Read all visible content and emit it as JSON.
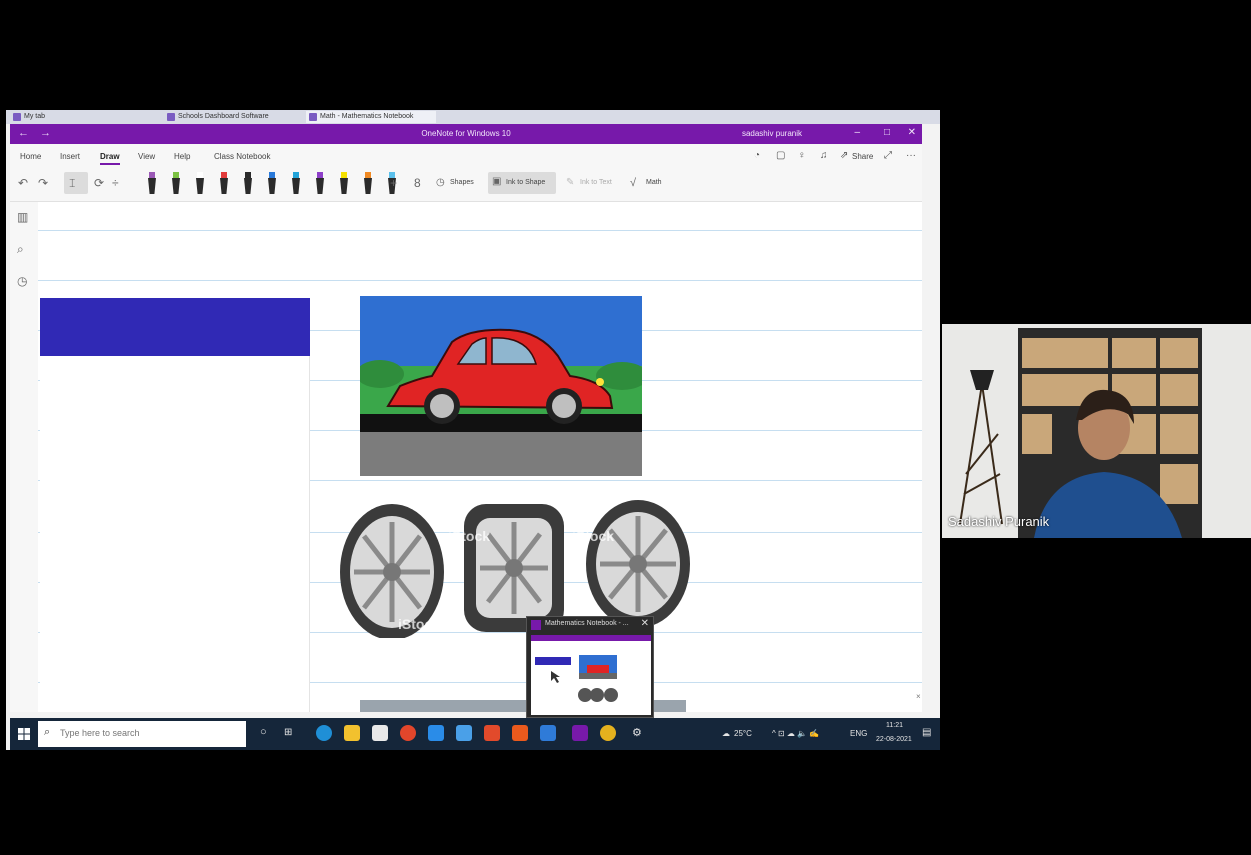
{
  "browser": {
    "tabs": [
      "My tab",
      "Schools Dashboard Software",
      "Math - Mathematics Notebook"
    ]
  },
  "window": {
    "app_title": "OneNote for Windows 10",
    "user_name": "sadashiv puranik",
    "back": "←",
    "forward": "→",
    "minimize": "–",
    "maximize": "□",
    "close": "✕"
  },
  "menu": {
    "items": [
      "Home",
      "Insert",
      "Draw",
      "View",
      "Help",
      "Class Notebook"
    ],
    "active": "Draw",
    "share_label": "Share",
    "more": "···",
    "expand": "⤢"
  },
  "toolbar": {
    "undo": "↶",
    "redo": "↷",
    "add": "+",
    "shapes_label": "Shapes",
    "ink_to_shape_label": "Ink to Shape",
    "ink_to_text_label": "Ink to Text",
    "math_label": "Math",
    "pen_colors": [
      "#9b59b6",
      "#7cc242",
      "#ffffff",
      "#e23b3b",
      "#2b2b2b",
      "#2979d9",
      "#22a3d8",
      "#8e3fc9",
      "#f5e100",
      "#f08a24",
      "#5bc0eb"
    ]
  },
  "rail": {
    "notebooks_icon": "▥",
    "search_icon": "⌕",
    "recent_icon": "◷"
  },
  "canvas": {
    "watermark": "iStock",
    "scroll_close": "×"
  },
  "taskbar": {
    "search_placeholder": "Type here to search",
    "weather": "25°C",
    "lang": "ENG",
    "time": "11:21",
    "date": "22-08-2021",
    "tray_glyphs": "^ ⊡ ☁ 🔈 ✍"
  },
  "thumbnail": {
    "title": "Mathematics Notebook - ...",
    "close": "✕"
  },
  "video": {
    "participant_name": "Sadashiv Puranik"
  }
}
